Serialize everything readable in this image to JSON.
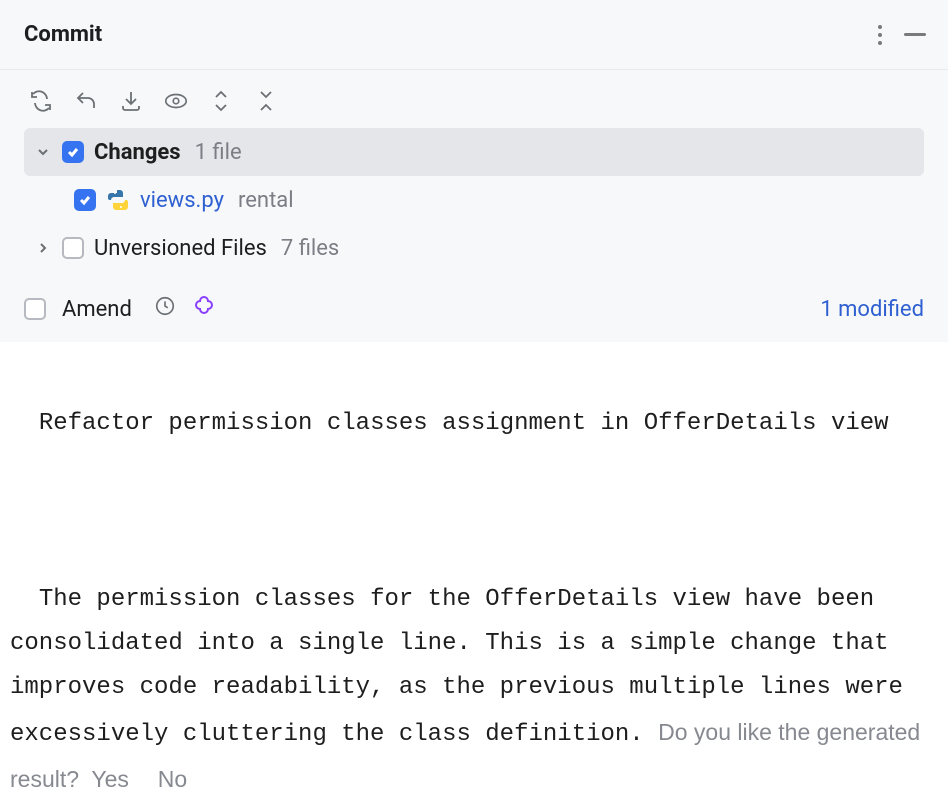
{
  "header": {
    "title": "Commit"
  },
  "toolbar": {
    "refresh": "refresh-icon",
    "revert": "revert-icon",
    "shelve": "shelve-icon",
    "preview": "preview-icon",
    "expand": "expand-icon",
    "collapse": "collapse-icon"
  },
  "tree": {
    "changes_label": "Changes",
    "changes_count": "1 file",
    "file": {
      "name": "views.py",
      "path": "rental"
    },
    "unversioned_label": "Unversioned Files",
    "unversioned_count": "7 files"
  },
  "amend": {
    "label": "Amend",
    "modified": "1 modified"
  },
  "message": {
    "subject": "Refactor permission classes assignment in OfferDetails view",
    "body": "The permission classes for the OfferDetails view have been consolidated into a single line. This is a simple change that improves code readability, as the previous multiple lines were excessively cluttering the class definition.",
    "prompt": "Do you like the generated result?",
    "yes": "Yes",
    "no": "No"
  }
}
